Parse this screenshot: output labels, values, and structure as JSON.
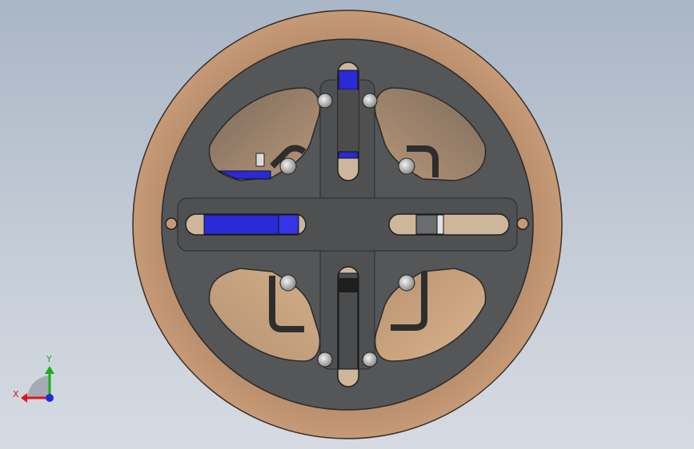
{
  "viewport": {
    "background_top": "#a9b6c6",
    "background_bottom": "#d6dbe2"
  },
  "model": {
    "ring_color": "#c79a77",
    "plate_color": "#555759",
    "slot_color": "#c7b093",
    "slider_color": "#2a2ad6",
    "screw_color": "#c9c9c9"
  },
  "triad": {
    "x_label": "X",
    "y_label": "Y",
    "x_color": "#e0141e",
    "y_color": "#17b017",
    "z_color": "#1a2ee0",
    "icons": [
      "x-axis-arrow",
      "y-axis-arrow",
      "z-axis-dot"
    ]
  }
}
